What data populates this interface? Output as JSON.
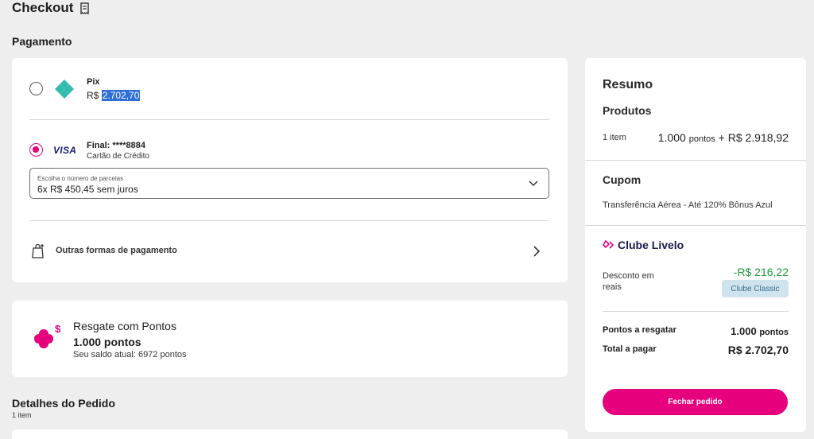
{
  "header": {
    "title": "Checkout",
    "icon": "receipt-icon"
  },
  "payment": {
    "section_title": "Pagamento",
    "pix": {
      "title": "Pix",
      "currency": "R$",
      "amount": "2.702,70"
    },
    "card": {
      "brand": "VISA",
      "final": "Final: ****8884",
      "type": "Cartão de Crédito",
      "installments_label": "Escolha o número de parcelas",
      "installments_value": "6x R$ 450,45 sem juros"
    },
    "other": "Outras formas de pagamento",
    "accent": "#e6007e"
  },
  "redeem": {
    "title": "Resgate com Pontos",
    "points": "1.000 pontos",
    "balance": "Seu saldo atual: 6972 pontos"
  },
  "details": {
    "title": "Detalhes do Pedido",
    "count": "1 item"
  },
  "summary": {
    "title": "Resumo",
    "products_label": "Produtos",
    "items": "1 item",
    "points_value": "1.000",
    "points_unit": "pontos",
    "price_rest": "+ R$ 2.918,92",
    "coupon_label": "Cupom",
    "coupon_value": "Transferência Aérea - Até 120% Bônus Azul",
    "clube_label": "Clube Livelo",
    "discount_label": "Desconto em reais",
    "discount_value": "-R$ 216,22",
    "club_badge": "Clube Classic",
    "redeem_label": "Pontos a resgatar",
    "redeem_value": "1.000",
    "redeem_unit": "pontos",
    "total_label": "Total a pagar",
    "total_value": "R$ 2.702,70",
    "button": "Fechar pedido"
  }
}
